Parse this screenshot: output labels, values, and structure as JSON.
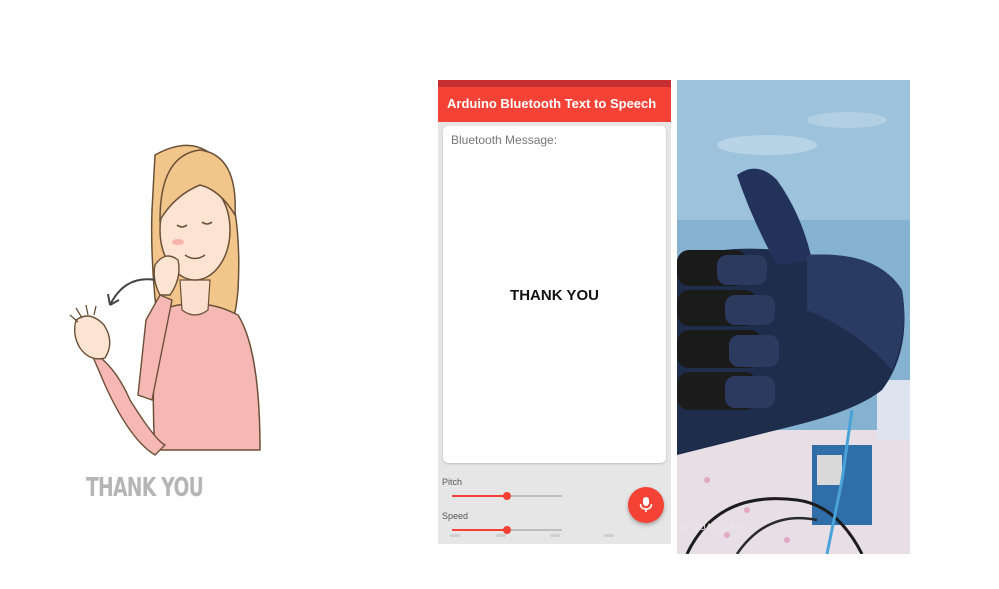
{
  "illustration": {
    "caption": "THANK YOU"
  },
  "app": {
    "title": "Arduino Bluetooth Text to Speech",
    "message_label": "Bluetooth Message:",
    "message": "THANK YOU",
    "pitch_label": "Pitch",
    "pitch_level": 0.5,
    "speed_label": "Speed",
    "speed_level": 0.5,
    "mic_icon": "microphone-icon",
    "accent_color": "#f44336"
  },
  "photo": {
    "watermark": "AI QUAD CAM"
  }
}
